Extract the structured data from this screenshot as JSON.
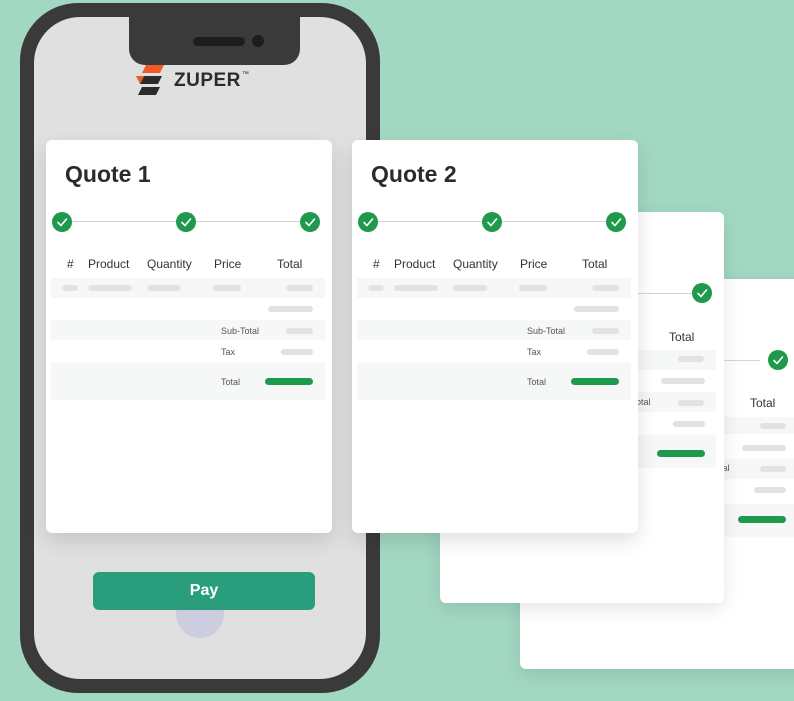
{
  "app": {
    "brand": "ZUPER",
    "trademark": "™"
  },
  "quotes": [
    {
      "title": "Quote 1"
    },
    {
      "title": "Quote 2"
    }
  ],
  "table": {
    "columns": [
      "#",
      "Product",
      "Quantity",
      "Price",
      "Total"
    ],
    "summary": {
      "subtotal_label": "Sub-Total",
      "tax_label": "Tax",
      "total_label": "Total"
    }
  },
  "back_cards": {
    "total_label": "Total",
    "total_row_label_fragment": "otal",
    "total_row_label_fragment_2": "tal"
  },
  "actions": {
    "pay_label": "Pay"
  },
  "colors": {
    "background": "#a2d8c2",
    "accent": "#2a9d7c",
    "check": "#1f9a4d",
    "logo_orange": "#f05a28"
  },
  "icons": {
    "step": "check-circle-icon",
    "logo": "zuper-logo-icon"
  }
}
